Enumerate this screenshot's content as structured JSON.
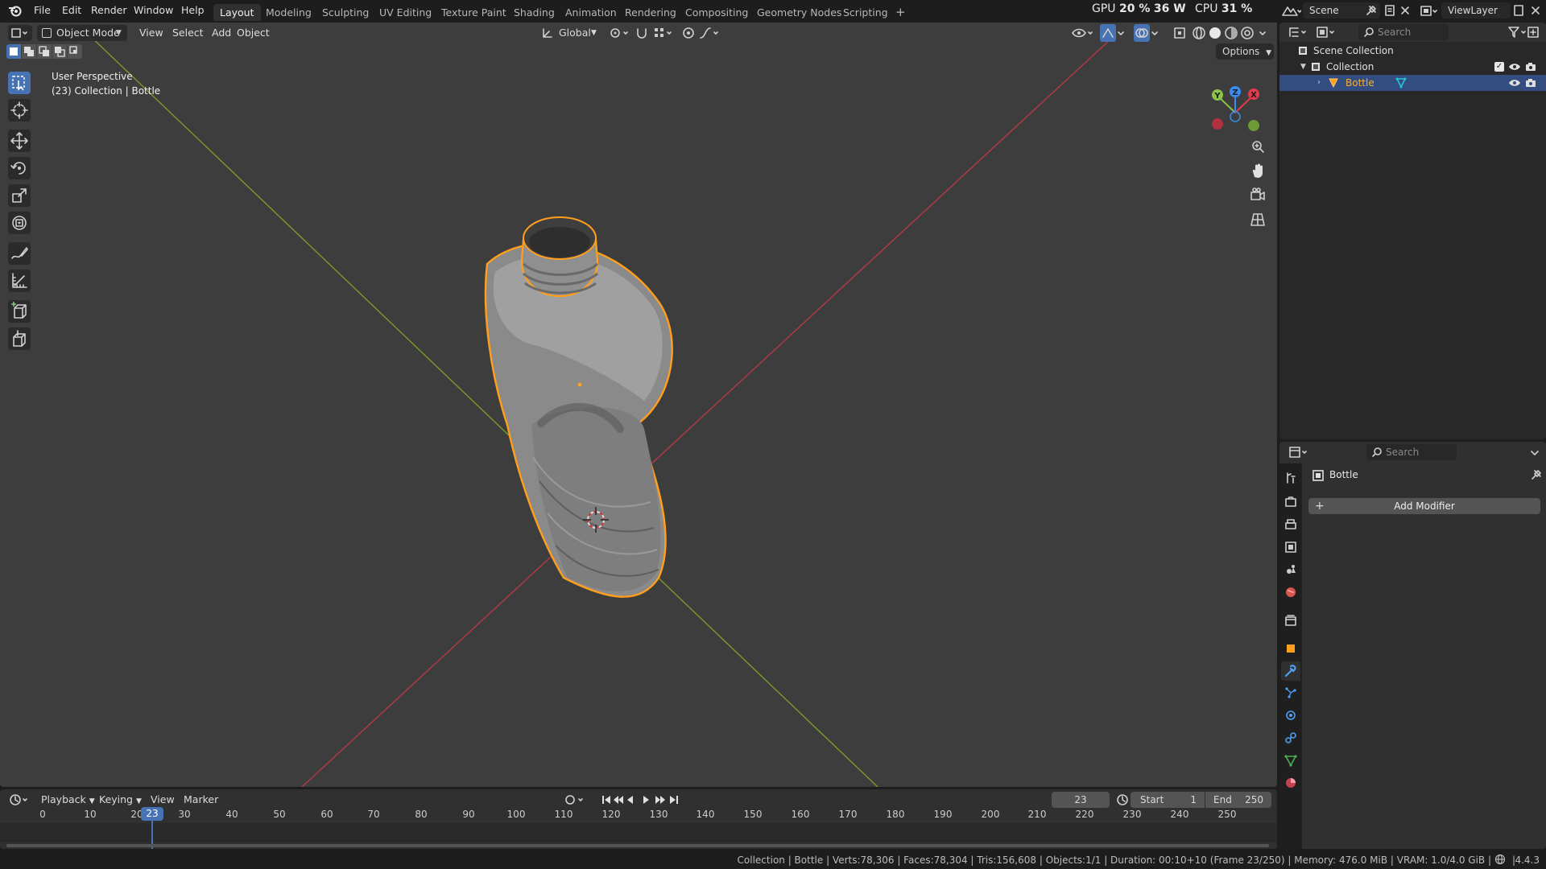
{
  "menus": [
    "File",
    "Edit",
    "Render",
    "Window",
    "Help"
  ],
  "workspaces": [
    "Layout",
    "Modeling",
    "Sculpting",
    "UV Editing",
    "Texture Paint",
    "Shading",
    "Animation",
    "Rendering",
    "Compositing",
    "Geometry Nodes",
    "Scripting"
  ],
  "active_workspace": "Layout",
  "add_workspace_symbol": "+",
  "stats": {
    "gpu_label": "GPU",
    "gpu_value": "20 %",
    "gpu_power": "36 W",
    "cpu_label": "CPU",
    "cpu_value": "31 %"
  },
  "scene": {
    "name": "Scene",
    "view_layer": "ViewLayer"
  },
  "viewport_header": {
    "mode": "Object Mode",
    "menus": [
      "View",
      "Select",
      "Add",
      "Object"
    ],
    "orientation": "Global",
    "options_label": "Options"
  },
  "viewport_info": {
    "line1": "User Perspective",
    "line2": "(23) Collection | Bottle"
  },
  "gizmo": {
    "x": "X",
    "y": "Y",
    "z": "Z"
  },
  "outliner": {
    "search_placeholder": "Search",
    "items": [
      {
        "label": "Scene Collection"
      },
      {
        "label": "Collection"
      },
      {
        "label": "Bottle"
      }
    ]
  },
  "properties": {
    "search_placeholder": "Search",
    "object_name": "Bottle",
    "add_modifier_label": "Add Modifier"
  },
  "timeline": {
    "menus": [
      "Playback",
      "Keying",
      "View",
      "Marker"
    ],
    "current_frame": "23",
    "start_label": "Start",
    "start_value": "1",
    "end_label": "End",
    "end_value": "250",
    "ticks": [
      "0",
      "10",
      "20",
      "30",
      "40",
      "50",
      "60",
      "70",
      "80",
      "90",
      "100",
      "110",
      "120",
      "130",
      "140",
      "150",
      "160",
      "170",
      "180",
      "190",
      "200",
      "210",
      "220",
      "230",
      "240",
      "250"
    ],
    "playhead_label": "23"
  },
  "statusbar": "Collection | Bottle | Verts:78,306 | Faces:78,304 | Tris:156,608 | Objects:1/1 | Duration: 00:10+10 (Frame 23/250) | Memory: 476.0 MiB | VRAM: 1.0/4.0 GiB |",
  "version": "4.4.3",
  "colors": {
    "accent": "#4772b3",
    "selection": "#ff9f1c",
    "x_axis": "#e33a4d",
    "y_axis": "#8bc34a",
    "z_axis": "#3a8cf0"
  }
}
